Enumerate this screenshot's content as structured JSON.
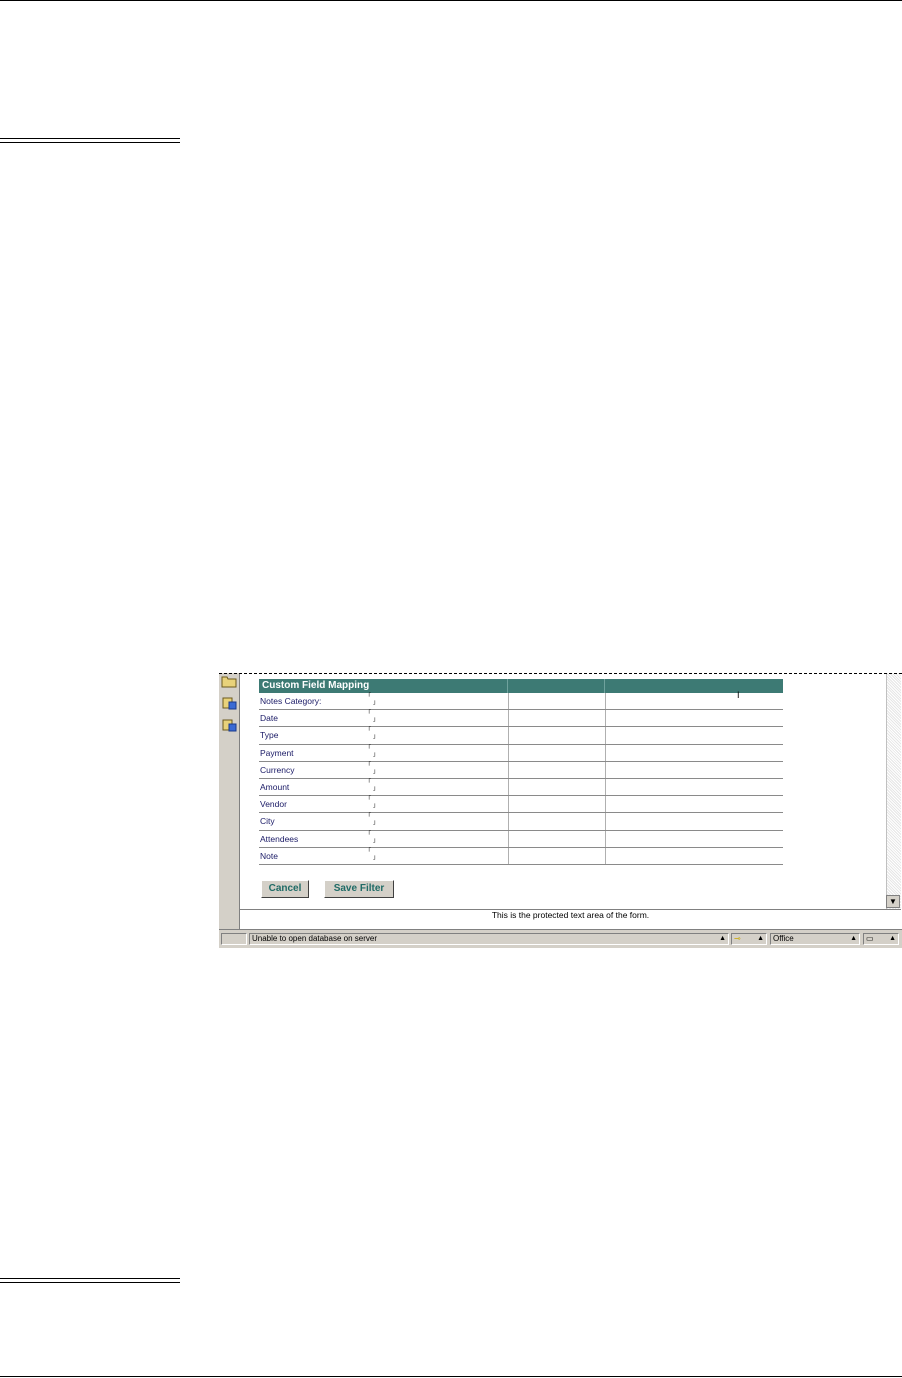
{
  "form": {
    "header_title": "Custom Field Mapping",
    "rows": [
      {
        "label": "Notes Category:"
      },
      {
        "label": "Date"
      },
      {
        "label": "Type"
      },
      {
        "label": "Payment"
      },
      {
        "label": "Currency"
      },
      {
        "label": "Amount"
      },
      {
        "label": "Vendor"
      },
      {
        "label": "City"
      },
      {
        "label": "Attendees"
      },
      {
        "label": "Note"
      }
    ],
    "field_open_mark": "「",
    "field_close_mark": "」",
    "cancel_label": "Cancel",
    "save_filter_label": "Save Filter"
  },
  "protected_text": "This is the protected text area of the form.",
  "statusbar": {
    "message": "Unable to open database  on server",
    "location": "Office"
  },
  "icons": [
    "folder-icon",
    "database-icon",
    "database-icon"
  ],
  "colors": {
    "header": "#3d7a74",
    "button_text": "#1f6b66",
    "label_text": "#1a1a66"
  }
}
